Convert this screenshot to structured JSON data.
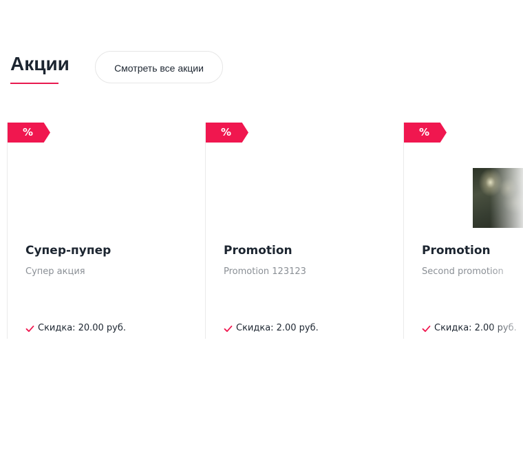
{
  "section": {
    "title": "Акции",
    "view_all_label": "Смотреть все акции"
  },
  "colors": {
    "accent": "#f0174f",
    "text": "#1c2530",
    "muted": "#8a8f95"
  },
  "badge_icon": "percent-icon",
  "badge_text": "%",
  "promotions": [
    {
      "title": "Супер-пупер",
      "subtitle": "Супер акция",
      "discount_label": "Скидка:",
      "discount_value": "20.00 руб."
    },
    {
      "title": "Promotion",
      "subtitle": "Promotion 123123",
      "discount_label": "Скидка:",
      "discount_value": "2.00 руб."
    },
    {
      "title": "Promotion",
      "subtitle": "Second promotion",
      "discount_label": "Скидка:",
      "discount_value": "2.00 руб."
    }
  ]
}
